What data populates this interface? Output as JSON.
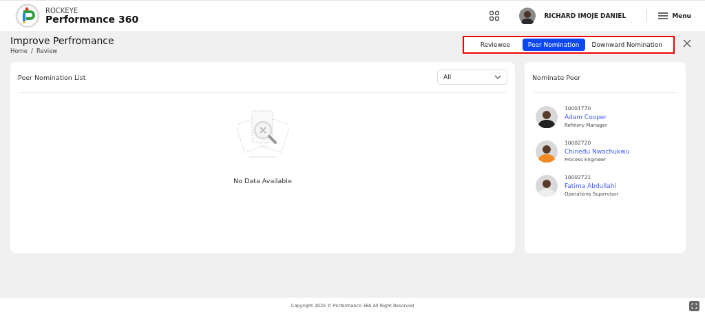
{
  "header": {
    "brand_small": "ROCKEYE",
    "brand": "Performance 360",
    "user_name": "RICHARD IMOJE DANIEL",
    "menu_label": "Menu"
  },
  "page": {
    "title": "Improve Perfromance",
    "breadcrumb": [
      "Home",
      "Review"
    ],
    "breadcrumb_separator": "/"
  },
  "tabs": [
    {
      "label": "Reviewee",
      "selected": false
    },
    {
      "label": "Peer Nomination",
      "selected": true
    },
    {
      "label": "Downward Nomination",
      "selected": false
    }
  ],
  "list_card": {
    "title": "Peer Nomination List",
    "filter": {
      "value": "All"
    },
    "empty_text": "No Data Available"
  },
  "nominate": {
    "title": "Nominate Peer",
    "peers": [
      {
        "id": "10001770",
        "name": "Adam Cooper",
        "role": "Refinery Manager"
      },
      {
        "id": "10002720",
        "name": "Chinedu Nwachukwu",
        "role": "Process Engineer"
      },
      {
        "id": "10002721",
        "name": "Fatima Abdullahi",
        "role": "Operations Supervisor"
      }
    ]
  },
  "footer": {
    "copyright": "Copyright 2025 © Performance 360 All Right Reserved"
  }
}
